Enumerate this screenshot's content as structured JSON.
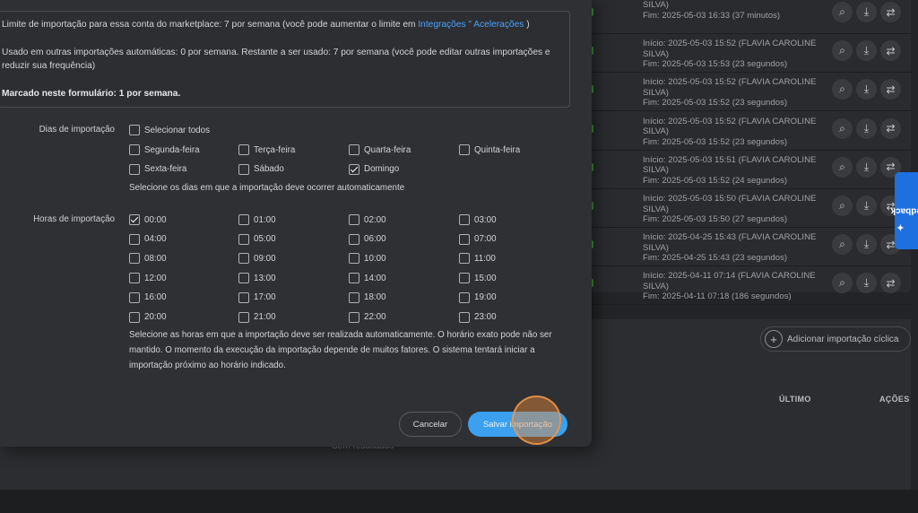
{
  "background": {
    "rows": [
      {
        "start": "",
        "start_cont": "SILVA)",
        "end": "Fim: 2025-05-03 16:33 (37 minutos)"
      },
      {
        "start": "Início: 2025-05-03 15:52 (FLAVIA CAROLINE",
        "start_cont": "SILVA)",
        "end": "Fim: 2025-05-03 15:53 (23 segundos)"
      },
      {
        "start": "Início: 2025-05-03 15:52 (FLAVIA CAROLINE",
        "start_cont": "SILVA)",
        "end": "Fim: 2025-05-03 15:52 (23 segundos)"
      },
      {
        "start": "Início: 2025-05-03 15:52 (FLAVIA CAROLINE",
        "start_cont": "SILVA)",
        "end": "Fim: 2025-05-03 15:52 (23 segundos)"
      },
      {
        "start": "Início: 2025-05-03 15:51 (FLAVIA CAROLINE",
        "start_cont": "SILVA)",
        "end": "Fim: 2025-05-03 15:52 (24 segundos)"
      },
      {
        "start": "Início: 2025-05-03 15:50 (FLAVIA CAROLINE",
        "start_cont": "SILVA)",
        "end": "Fim: 2025-05-03 15:50 (27 segundos)"
      },
      {
        "start": "Início: 2025-04-25 15:43 (FLAVIA CAROLINE",
        "start_cont": "SILVA)",
        "end": "Fim: 2025-04-25 15:43 (23 segundos)"
      },
      {
        "start": "Início: 2025-04-11 07:14 (FLAVIA CAROLINE",
        "start_cont": "SILVA)",
        "end": "Fim: 2025-04-11 07:18 (186 segundos)"
      }
    ],
    "add_button_label": "Adicionar importação cíclica",
    "col_last": "ÚLTIMO",
    "col_actions": "AÇÕES",
    "empty_text": "Sem resultados",
    "feedback_label": "Feedback",
    "icons": [
      "search-icon",
      "download-icon",
      "sync-icon"
    ]
  },
  "info": {
    "limit_text": "Limite de importação para essa conta do marketplace: 7 por semana (você pode aumentar o limite em ",
    "limit_link": "Integrações \" Acelerações",
    "limit_end": " )",
    "used_text": "Usado em outras importações automáticas: 0 por semana. Restante a ser usado: 7 por semana (você pode editar outras importações e",
    "used_text2": "reduzir sua frequência)",
    "marked_text": "Marcado neste formulário: 1 por semana."
  },
  "days": {
    "label": "Dias de importação",
    "select_all": "Selecionar todos",
    "items": [
      {
        "label": "Segunda-feira",
        "checked": false
      },
      {
        "label": "Terça-feira",
        "checked": false
      },
      {
        "label": "Quarta-feira",
        "checked": false
      },
      {
        "label": "Quinta-feira",
        "checked": false
      },
      {
        "label": "Sexta-feira",
        "checked": false
      },
      {
        "label": "Sábado",
        "checked": false
      },
      {
        "label": "Domingo",
        "checked": true
      }
    ],
    "hint": "Selecione os dias em que a importação deve ocorrer automaticamente"
  },
  "hours": {
    "label": "Horas de importação",
    "items": [
      {
        "label": "00:00",
        "checked": true
      },
      {
        "label": "01:00",
        "checked": false
      },
      {
        "label": "02:00",
        "checked": false
      },
      {
        "label": "03:00",
        "checked": false
      },
      {
        "label": "04:00",
        "checked": false
      },
      {
        "label": "05:00",
        "checked": false
      },
      {
        "label": "06:00",
        "checked": false
      },
      {
        "label": "07:00",
        "checked": false
      },
      {
        "label": "08:00",
        "checked": false
      },
      {
        "label": "09:00",
        "checked": false
      },
      {
        "label": "10:00",
        "checked": false
      },
      {
        "label": "11:00",
        "checked": false
      },
      {
        "label": "12:00",
        "checked": false
      },
      {
        "label": "13:00",
        "checked": false
      },
      {
        "label": "14:00",
        "checked": false
      },
      {
        "label": "15:00",
        "checked": false
      },
      {
        "label": "16:00",
        "checked": false
      },
      {
        "label": "17:00",
        "checked": false
      },
      {
        "label": "18:00",
        "checked": false
      },
      {
        "label": "19:00",
        "checked": false
      },
      {
        "label": "20:00",
        "checked": false
      },
      {
        "label": "21:00",
        "checked": false
      },
      {
        "label": "22:00",
        "checked": false
      },
      {
        "label": "23:00",
        "checked": false
      }
    ],
    "hint_lines": [
      "Selecione as horas em que a importação deve ser realizada automaticamente. O horário exato pode não ser",
      "mantido. O momento da execução da importação depende de muitos fatores. O sistema tentará iniciar a",
      "importação próximo ao horário indicado."
    ]
  },
  "actions": {
    "cancel": "Cancelar",
    "save": "Salvar importação"
  },
  "colors": {
    "accent": "#3ba0ef",
    "link": "#4aa3ff",
    "feedback": "#1e6fe0",
    "badge_green": "#3f8f3a",
    "click_marker": "#e88a3c"
  }
}
